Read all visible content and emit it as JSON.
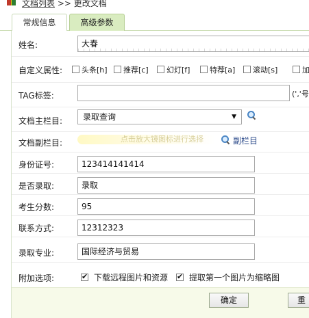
{
  "breadcrumb": {
    "list_link": "文档列表",
    "separator": ">>",
    "current": "更改文档"
  },
  "tabs": [
    {
      "label": "常规信息"
    },
    {
      "label": "高级参数"
    }
  ],
  "fields": {
    "name": {
      "label": "姓名:",
      "value": "大春"
    },
    "attributes": {
      "label": "自定义属性:",
      "options": [
        "头条[h]",
        "推荐[c]",
        "幻灯[f]",
        "特荐[a]",
        "滚动[s]",
        "加"
      ]
    },
    "tags": {
      "label": "TAG标签:",
      "value": "",
      "note": "(','号"
    },
    "main_column": {
      "label": "文档主栏目:",
      "value": "录取查询"
    },
    "sub_column": {
      "label": "文档副栏目:",
      "hint": "点击放大镜图标进行选择",
      "link": "副栏目"
    },
    "id_number": {
      "label": "身份证号:",
      "value": "123414141414"
    },
    "admitted": {
      "label": "是否录取:",
      "value": "录取"
    },
    "score": {
      "label": "考生分数:",
      "value": "95"
    },
    "contact": {
      "label": "联系方式:",
      "value": "12312323"
    },
    "major": {
      "label": "录取专业:",
      "value": "国际经济与贸易"
    },
    "extras": {
      "label": "附加选项:",
      "options": [
        {
          "label": "下载远程图片和资源",
          "checked": true
        },
        {
          "label": "提取第一个图片为缩略图",
          "checked": true
        }
      ]
    }
  },
  "buttons": {
    "ok": "确定",
    "reset": "重置"
  },
  "colors": {
    "active_tab": "#d9ecc0",
    "footer_bg": "#f7fae9",
    "link": "#2b4a8a"
  }
}
